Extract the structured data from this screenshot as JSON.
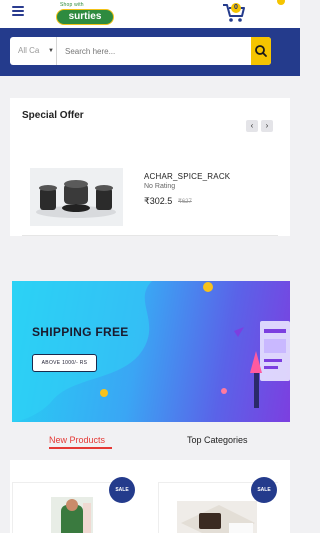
{
  "header": {
    "logo_top": "Shop with",
    "logo_text": "surties",
    "cart_count": "0"
  },
  "search": {
    "category_label": "All Ca",
    "placeholder": "Search here..."
  },
  "special_offer": {
    "title": "Special Offer",
    "product": {
      "name": "ACHAR_SPICE_RACK",
      "rating": "No Rating",
      "price": "₹302.5",
      "old_price": "₹627"
    }
  },
  "banner": {
    "title": "SHIPPING FREE",
    "button": "ABOVE 1000/- RS"
  },
  "tabs": {
    "new_products": "New Products",
    "top_categories": "Top Categories"
  },
  "products": [
    {
      "badge": "SALE"
    },
    {
      "badge": "SALE"
    }
  ],
  "colors": {
    "primary": "#243b8c",
    "accent": "#f5c400",
    "active_tab": "#e53935"
  }
}
